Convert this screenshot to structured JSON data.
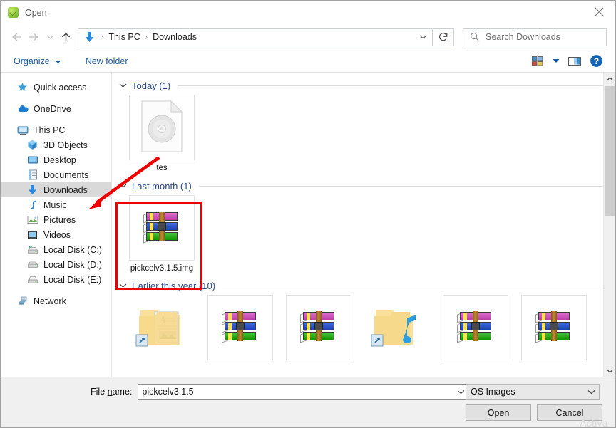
{
  "window": {
    "title": "Open",
    "app_icon": "green-app-icon",
    "close_icon": "close-icon"
  },
  "nav": {
    "back_icon": "back-arrow-icon",
    "forward_icon": "forward-arrow-icon",
    "recent_icon": "chevron-down-icon",
    "up_icon": "up-arrow-icon",
    "breadcrumb_icon": "downloads-arrow-icon",
    "breadcrumb": [
      "This PC",
      "Downloads"
    ],
    "separator": "›",
    "address_dropdown_icon": "chevron-down-icon",
    "refresh_icon": "refresh-icon"
  },
  "search": {
    "placeholder": "Search Downloads",
    "icon": "search-icon"
  },
  "commandbar": {
    "organize": "Organize",
    "organize_caret": "caret-down-icon",
    "new_folder": "New folder",
    "view_icon": "view-options-icon",
    "view_caret": "chevron-down-icon",
    "preview_icon": "preview-pane-icon",
    "help_icon": "help-icon"
  },
  "sidebar": {
    "items": [
      {
        "label": "Quick access",
        "icon": "star-icon",
        "indent": false,
        "selected": false
      },
      {
        "label": "OneDrive",
        "icon": "cloud-icon",
        "indent": false,
        "selected": false
      },
      {
        "label": "This PC",
        "icon": "monitor-icon",
        "indent": false,
        "selected": false
      },
      {
        "label": "3D Objects",
        "icon": "cube-icon",
        "indent": true,
        "selected": false
      },
      {
        "label": "Desktop",
        "icon": "desktop-icon",
        "indent": true,
        "selected": false
      },
      {
        "label": "Documents",
        "icon": "documents-icon",
        "indent": true,
        "selected": false
      },
      {
        "label": "Downloads",
        "icon": "downloads-arrow-icon",
        "indent": true,
        "selected": true
      },
      {
        "label": "Music",
        "icon": "music-note-icon",
        "indent": true,
        "selected": false
      },
      {
        "label": "Pictures",
        "icon": "pictures-icon",
        "indent": true,
        "selected": false
      },
      {
        "label": "Videos",
        "icon": "videos-icon",
        "indent": true,
        "selected": false
      },
      {
        "label": "Local Disk (C:)",
        "icon": "local-disk-icon",
        "indent": true,
        "selected": false
      },
      {
        "label": "Local Disk (D:)",
        "icon": "local-disk-icon",
        "indent": true,
        "selected": false
      },
      {
        "label": "Local Disk (E:)",
        "icon": "local-disk-icon",
        "indent": true,
        "selected": false
      },
      {
        "label": "Network",
        "icon": "network-icon",
        "indent": false,
        "selected": false
      }
    ]
  },
  "filelist": {
    "groups": [
      {
        "header": "Today (1)",
        "chevron": "chevron-down-icon",
        "files": [
          {
            "label": "tes",
            "icon": "disc-image-file-icon"
          }
        ]
      },
      {
        "header": "Last month (1)",
        "chevron": "chevron-down-icon",
        "files": [
          {
            "label": "pickcelv3.1.5.img",
            "icon": "winrar-archive-icon",
            "highlighted": true
          }
        ]
      },
      {
        "header": "Earlier this year (10)",
        "chevron": "chevron-down-icon",
        "files": [
          {
            "label": "",
            "icon": "folder-document-shortcut-icon"
          },
          {
            "label": "",
            "icon": "winrar-archive-icon"
          },
          {
            "label": "",
            "icon": "winrar-archive-icon"
          },
          {
            "label": "",
            "icon": "folder-music-shortcut-icon"
          },
          {
            "label": "",
            "icon": "winrar-archive-icon"
          },
          {
            "label": "",
            "icon": "winrar-archive-icon"
          }
        ]
      }
    ],
    "scrollbar": {
      "up_icon": "scroll-up-icon",
      "down_icon": "scroll-down-icon"
    }
  },
  "footer": {
    "filename_label_before": "File ",
    "filename_label_underlined": "n",
    "filename_label_after": "ame:",
    "filename_value": "pickcelv3.1.5",
    "filename_caret": "chevron-down-icon",
    "filetype_value": "OS Images",
    "filetype_caret": "chevron-down-icon",
    "open_before": "",
    "open_underlined": "O",
    "open_after": "pen",
    "cancel_label": "Cancel"
  },
  "watermark": {
    "text": "Activa"
  },
  "annotations": {
    "rect_color": "#ef0000",
    "arrow_color": "#ef0000",
    "arrow_target": "Downloads",
    "rect_target": "pickcelv3.1.5.img"
  }
}
